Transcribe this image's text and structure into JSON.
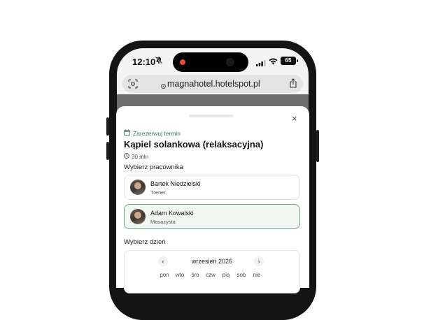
{
  "status_bar": {
    "time": "12:10",
    "battery": "65"
  },
  "browser": {
    "url": "magnahotel.hotelspot.pl"
  },
  "sheet": {
    "booking_label": "Zarezerwuj termin",
    "service_title": "Kąpiel solankowa (relaksacyjna)",
    "duration": "30 min",
    "employee_label": "Wybierz pracownika",
    "employees": [
      {
        "name": "Bartek Niedzielski",
        "role": "Trener",
        "selected": false
      },
      {
        "name": "Adam Kowalski",
        "role": "Masazysta",
        "selected": true
      }
    ],
    "day_label": "Wybierz dzień",
    "calendar": {
      "month": "wrzesień 2026",
      "prev": "‹",
      "next": "›",
      "weekdays": [
        "pon",
        "wto",
        "śro",
        "czw",
        "pią",
        "sob",
        "nie"
      ]
    },
    "close": "×"
  },
  "colors": {
    "accent": "#2e7d57",
    "selected_bg": "#f1f8f3",
    "selected_border": "#6ea488"
  },
  "icons": [
    "bell-muted-icon",
    "signal-icon",
    "wifi-icon",
    "battery-icon",
    "lens-icon",
    "site-info-icon",
    "share-icon",
    "calendar-icon",
    "clock-icon",
    "close-icon",
    "chevron-left-icon",
    "chevron-right-icon"
  ]
}
